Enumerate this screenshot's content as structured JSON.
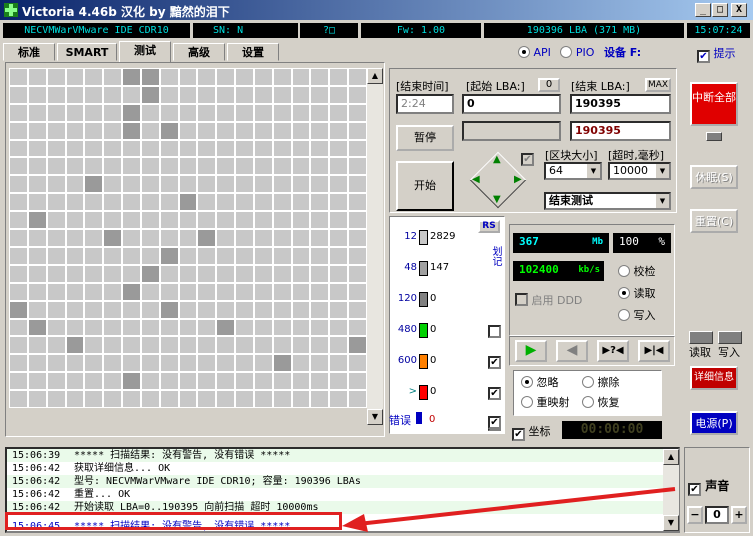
{
  "window": {
    "title": "Victoria 4.46b 汉化 by 黯然的泪下",
    "controls": [
      "_",
      "□",
      "X"
    ]
  },
  "info": {
    "model": "NECVMWarVMware IDE CDR10",
    "sn": "SN: N",
    "mid": "?□",
    "fw": "Fw: 1.00",
    "lba": "190396 LBA (371 MB)",
    "time": "15:07:24"
  },
  "tabs": [
    "标准",
    "SMART",
    "测试",
    "高级",
    "设置"
  ],
  "mode": {
    "api": "API",
    "pio": "PIO",
    "device": "设备 F:",
    "hint": "提示"
  },
  "range": {
    "end_time_label": "[结束时间]",
    "start_lba_label": "[起始 LBA:]",
    "start_btn": "0",
    "end_lba_label": "[结束 LBA:]",
    "max_btn": "MAX",
    "end_time_value": "2:24",
    "start_lba": "0",
    "end_lba": "190395",
    "end_lba2": "190395",
    "pause": "暂停",
    "start": "开始"
  },
  "block": {
    "size_label": "[区块大小]",
    "timeout_label": "[超时,毫秒]",
    "size": "64",
    "timeout": "10000",
    "end_action": "结束测试"
  },
  "hist": {
    "rs": "RS",
    "rows": [
      {
        "label": "12",
        "count": "2829",
        "color": "#c8c8c8"
      },
      {
        "label": "48",
        "count": "147",
        "color": "#a0a0a0"
      },
      {
        "label": "120",
        "count": "0",
        "color": "#808080"
      },
      {
        "label": "480",
        "count": "0",
        "color": "#00d000"
      },
      {
        "label": "600",
        "count": "0",
        "color": "#ff8000"
      },
      {
        "label": ">",
        "count": "0",
        "color": "#ff0000"
      }
    ],
    "err_label": "错误",
    "err_count": "0",
    "vert_label": "划记"
  },
  "stats": {
    "mb": "367",
    "mb_unit": "Mb",
    "pct": "100",
    "pct_unit": "%",
    "speed": "102400",
    "speed_unit": "kb/s",
    "ddd": "启用 DDD",
    "verify": "校检",
    "read": "读取",
    "write": "写入"
  },
  "repair": {
    "ignore": "忽略",
    "erase": "擦除",
    "remap": "重映射",
    "restore": "恢复",
    "coord": "坐标",
    "timer": "00:00:00"
  },
  "side": {
    "stop": "中断全部",
    "sleep": "休眠(S)",
    "reset": "重置(C)",
    "read": "读取",
    "write": "写入",
    "detail": "详细信息",
    "power": "电源(P)",
    "sound": "声音",
    "ata_value": "0"
  },
  "log": [
    {
      "t": "15:06:39",
      "m": "***** 扫描结果: 没有警告, 没有错误 *****"
    },
    {
      "t": "15:06:42",
      "m": "获取详细信息... OK"
    },
    {
      "t": "15:06:42",
      "m": "型号:  NECVMWarVMware IDE CDR10;     容量: 190396 LBAs"
    },
    {
      "t": "15:06:42",
      "m": "重置... OK"
    },
    {
      "t": "15:06:42",
      "m": "开始读取  LBA=0..190395  向前扫描  超时 10000ms"
    },
    {
      "t": "15:06:45",
      "m": "***** 扫描结果: 没有警告, 没有错误 *****"
    }
  ]
}
